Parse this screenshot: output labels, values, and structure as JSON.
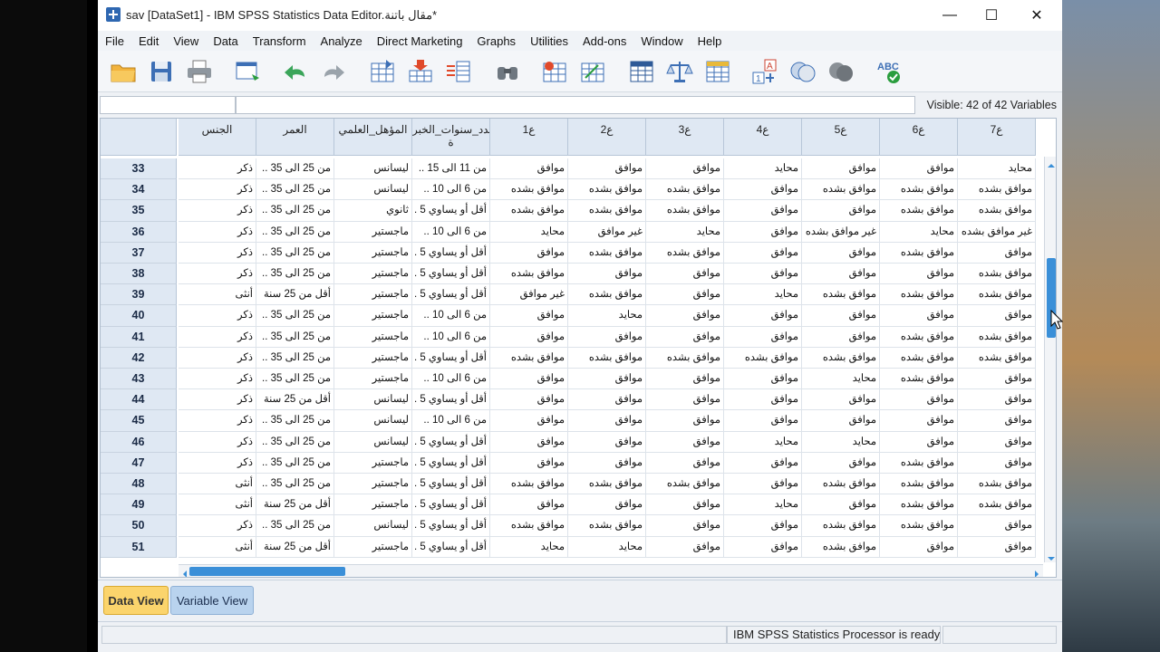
{
  "window": {
    "title": "sav [DataSet1] - IBM SPSS Statistics Data Editor.مقال باتنة*",
    "minimize": "—",
    "maximize": "☐",
    "close": "✕"
  },
  "menu": [
    "File",
    "Edit",
    "View",
    "Data",
    "Transform",
    "Analyze",
    "Direct Marketing",
    "Graphs",
    "Utilities",
    "Add-ons",
    "Window",
    "Help"
  ],
  "toolbar": {
    "icons": [
      "open-folder-icon",
      "save-icon",
      "print-icon",
      "dialog-recall-icon",
      "undo-icon",
      "redo-icon",
      "goto-case-icon",
      "goto-variable-icon",
      "variables-icon",
      "find-icon",
      "insert-cases-icon",
      "insert-variable-icon",
      "split-file-icon",
      "weight-cases-icon",
      "select-cases-icon",
      "value-labels-icon",
      "use-sets-icon",
      "show-all-variables-icon",
      "spell-check-icon"
    ]
  },
  "edit_row": {
    "visible_label": "Visible: 42 of 42 Variables"
  },
  "grid": {
    "columns": [
      "الجنس",
      "العمر",
      "المؤهل_العلمي",
      "عدد_سنوات_الخبر\nة",
      "ع1",
      "ع2",
      "ع3",
      "ع4",
      "ع5",
      "ع6",
      "ع7"
    ],
    "rows": [
      {
        "num": "33",
        "cells": [
          "ذكر",
          "من 25 الى 35 ..",
          "ليسانس",
          "من 11 الى 15 ..",
          "موافق",
          "موافق",
          "موافق",
          "محايد",
          "موافق",
          "موافق",
          "محايد"
        ]
      },
      {
        "num": "34",
        "cells": [
          "ذكر",
          "من 25 الى 35 ..",
          "ليسانس",
          "من 6 الى 10 ..",
          "موافق بشده",
          "موافق بشده",
          "موافق بشده",
          "موافق",
          "موافق بشده",
          "موافق بشده",
          "موافق بشده"
        ]
      },
      {
        "num": "35",
        "cells": [
          "ذكر",
          "من 25 الى 35 ..",
          "ثانوي",
          "أقل أو يساوي 5 .",
          "موافق بشده",
          "موافق بشده",
          "موافق بشده",
          "موافق",
          "موافق",
          "موافق بشده",
          "موافق بشده"
        ]
      },
      {
        "num": "36",
        "cells": [
          "ذكر",
          "من 25 الى 35 ..",
          "ماجستير",
          "من 6 الى 10 ..",
          "محايد",
          "غير موافق",
          "محايد",
          "موافق",
          "غير موافق بشده",
          "محايد",
          "غير موافق بشده"
        ]
      },
      {
        "num": "37",
        "cells": [
          "ذكر",
          "من 25 الى 35 ..",
          "ماجستير",
          "أقل أو يساوي 5 .",
          "موافق",
          "موافق بشده",
          "موافق بشده",
          "موافق",
          "موافق",
          "موافق بشده",
          "موافق"
        ]
      },
      {
        "num": "38",
        "cells": [
          "ذكر",
          "من 25 الى 35 ..",
          "ماجستير",
          "أقل أو يساوي 5 .",
          "موافق بشده",
          "موافق",
          "موافق",
          "موافق",
          "موافق",
          "موافق",
          "موافق بشده"
        ]
      },
      {
        "num": "39",
        "cells": [
          "أنثى",
          "أقل من 25 سنة",
          "ماجستير",
          "أقل أو يساوي 5 .",
          "غير موافق",
          "موافق بشده",
          "موافق",
          "محايد",
          "موافق بشده",
          "موافق بشده",
          "موافق بشده"
        ]
      },
      {
        "num": "40",
        "cells": [
          "ذكر",
          "من 25 الى 35 ..",
          "ماجستير",
          "من 6 الى 10 ..",
          "موافق",
          "محايد",
          "موافق",
          "موافق",
          "موافق",
          "موافق",
          "موافق"
        ]
      },
      {
        "num": "41",
        "cells": [
          "ذكر",
          "من 25 الى 35 ..",
          "ماجستير",
          "من 6 الى 10 ..",
          "موافق",
          "موافق",
          "موافق",
          "موافق",
          "موافق",
          "موافق بشده",
          "موافق بشده"
        ]
      },
      {
        "num": "42",
        "cells": [
          "ذكر",
          "من 25 الى 35 ..",
          "ماجستير",
          "أقل أو يساوي 5 .",
          "موافق بشده",
          "موافق بشده",
          "موافق بشده",
          "موافق بشده",
          "موافق بشده",
          "موافق بشده",
          "موافق بشده"
        ]
      },
      {
        "num": "43",
        "cells": [
          "ذكر",
          "من 25 الى 35 ..",
          "ماجستير",
          "من 6 الى 10 ..",
          "موافق",
          "موافق",
          "موافق",
          "موافق",
          "محايد",
          "موافق بشده",
          "موافق"
        ]
      },
      {
        "num": "44",
        "cells": [
          "ذكر",
          "أقل من 25 سنة",
          "ليسانس",
          "أقل أو يساوي 5 .",
          "موافق",
          "موافق",
          "موافق",
          "موافق",
          "موافق",
          "موافق",
          "موافق"
        ]
      },
      {
        "num": "45",
        "cells": [
          "ذكر",
          "من 25 الى 35 ..",
          "ليسانس",
          "من 6 الى 10 ..",
          "موافق",
          "موافق",
          "موافق",
          "موافق",
          "موافق",
          "موافق",
          "موافق"
        ]
      },
      {
        "num": "46",
        "cells": [
          "ذكر",
          "من 25 الى 35 ..",
          "ليسانس",
          "أقل أو يساوي 5 .",
          "موافق",
          "موافق",
          "موافق",
          "محايد",
          "محايد",
          "موافق",
          "موافق"
        ]
      },
      {
        "num": "47",
        "cells": [
          "ذكر",
          "من 25 الى 35 ..",
          "ماجستير",
          "أقل أو يساوي 5 .",
          "موافق",
          "موافق",
          "موافق",
          "موافق",
          "موافق",
          "موافق بشده",
          "موافق"
        ]
      },
      {
        "num": "48",
        "cells": [
          "أنثى",
          "من 25 الى 35 ..",
          "ماجستير",
          "أقل أو يساوي 5 .",
          "موافق بشده",
          "موافق بشده",
          "موافق بشده",
          "موافق",
          "موافق بشده",
          "موافق بشده",
          "موافق بشده"
        ]
      },
      {
        "num": "49",
        "cells": [
          "أنثى",
          "أقل من 25 سنة",
          "ماجستير",
          "أقل أو يساوي 5 .",
          "موافق",
          "موافق",
          "موافق",
          "محايد",
          "موافق",
          "موافق بشده",
          "موافق بشده"
        ]
      },
      {
        "num": "50",
        "cells": [
          "ذكر",
          "من 25 الى 35 ..",
          "ليسانس",
          "أقل أو يساوي 5 .",
          "موافق بشده",
          "موافق بشده",
          "موافق",
          "موافق",
          "موافق بشده",
          "موافق بشده",
          "موافق"
        ]
      },
      {
        "num": "51",
        "cells": [
          "أنثى",
          "أقل من 25 سنة",
          "ماجستير",
          "أقل أو يساوي 5 .",
          "محايد",
          "محايد",
          "موافق",
          "موافق",
          "موافق بشده",
          "موافق",
          "موافق"
        ]
      }
    ]
  },
  "tabs": {
    "data_view": "Data View",
    "variable_view": "Variable View"
  },
  "status": {
    "processor": "IBM SPSS Statistics Processor is ready"
  },
  "colors": {
    "accent": "#3a8fd8",
    "active_tab": "#fbd46c",
    "inactive_tab": "#b9d3ee",
    "header_bg": "#dfe8f3"
  }
}
